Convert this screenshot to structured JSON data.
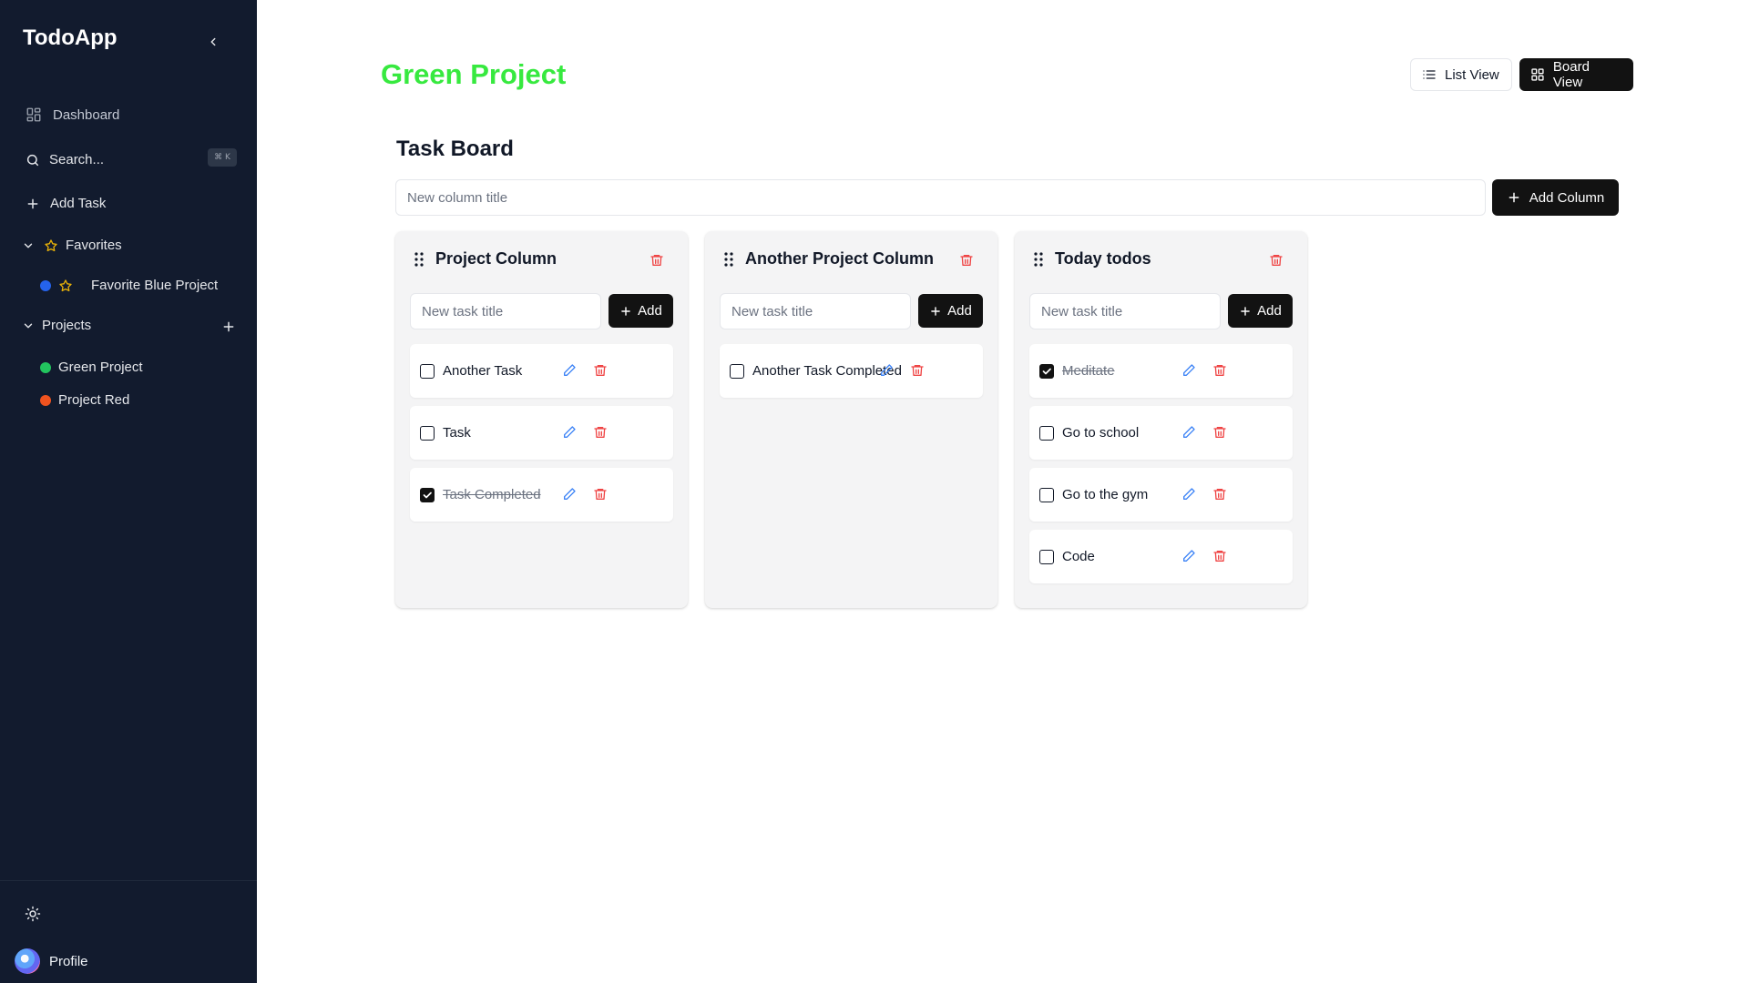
{
  "app": {
    "title": "TodoApp"
  },
  "sidebar": {
    "dashboard_label": "Dashboard",
    "search_label": "Search...",
    "search_shortcut": "⌘ K",
    "add_task_label": "Add Task",
    "favorites": {
      "label": "Favorites",
      "items": [
        {
          "label": "Favorite Blue Project",
          "color": "#2563eb"
        }
      ]
    },
    "projects": {
      "label": "Projects",
      "items": [
        {
          "label": "Green Project",
          "color": "#22c55e"
        },
        {
          "label": "Project Red",
          "color": "#f0531f"
        }
      ]
    },
    "profile_label": "Profile"
  },
  "header": {
    "project_title": "Green Project",
    "project_color": "#37e93f",
    "list_view_label": "List View",
    "board_view_label": "Board View"
  },
  "board": {
    "title": "Task Board",
    "new_column_placeholder": "New column title",
    "add_column_label": "Add Column",
    "new_task_placeholder": "New task title",
    "add_task_button_label": "Add",
    "columns": [
      {
        "title": "Project Column",
        "tasks": [
          {
            "title": "Another Task",
            "completed": false
          },
          {
            "title": "Task",
            "completed": false
          },
          {
            "title": "Task Completed",
            "completed": true
          }
        ]
      },
      {
        "title": "Another Project Column",
        "tasks": [
          {
            "title": "Another Task Completed",
            "completed": false
          }
        ]
      },
      {
        "title": "Today todos",
        "tasks": [
          {
            "title": "Meditate",
            "completed": true
          },
          {
            "title": "Go to school",
            "completed": false
          },
          {
            "title": "Go to the gym",
            "completed": false
          },
          {
            "title": "Code",
            "completed": false
          }
        ]
      }
    ]
  },
  "colors": {
    "sidebar_bg": "#121b2e",
    "primary_button": "#121212",
    "delete_icon": "#ef4444",
    "edit_icon": "#3b82f6",
    "favorite_star": "#eab308"
  }
}
